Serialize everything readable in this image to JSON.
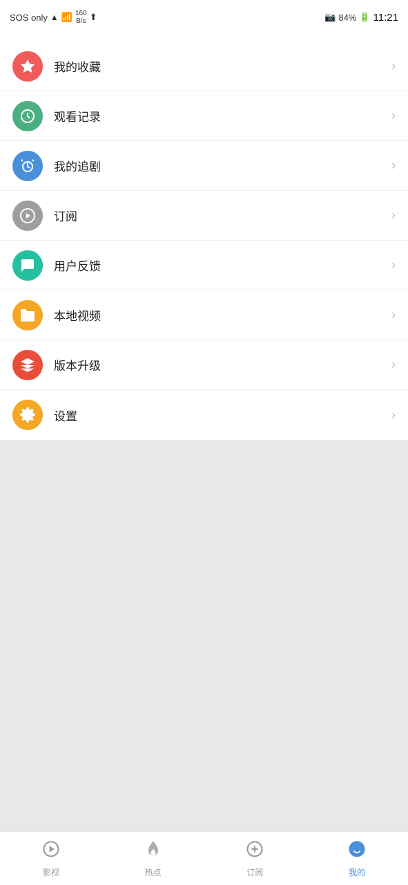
{
  "statusBar": {
    "sos": "SOS only",
    "signal": "!",
    "wifi": "WiFi",
    "speedNum": "160",
    "speedUnit": "B/s",
    "upload": "↑",
    "battery": "84%",
    "time": "11:21"
  },
  "menuItems": [
    {
      "id": "favorites",
      "label": "我的收藏",
      "iconColor": "color-red",
      "iconType": "star"
    },
    {
      "id": "history",
      "label": "观看记录",
      "iconColor": "color-green",
      "iconType": "clock"
    },
    {
      "id": "follow",
      "label": "我的追剧",
      "iconColor": "color-blue",
      "iconType": "alarm"
    },
    {
      "id": "subscribe",
      "label": "订阅",
      "iconColor": "color-gray",
      "iconType": "play"
    },
    {
      "id": "feedback",
      "label": "用户反馈",
      "iconColor": "color-teal",
      "iconType": "chat"
    },
    {
      "id": "local",
      "label": "本地视频",
      "iconColor": "color-orange",
      "iconType": "folder"
    },
    {
      "id": "update",
      "label": "版本升级",
      "iconColor": "color-multi",
      "iconType": "layers"
    },
    {
      "id": "settings",
      "label": "设置",
      "iconColor": "color-settings",
      "iconType": "gear"
    }
  ],
  "bottomNav": [
    {
      "id": "tv",
      "label": "影视",
      "iconType": "play-circle",
      "active": false
    },
    {
      "id": "hot",
      "label": "热点",
      "iconType": "fire",
      "active": false
    },
    {
      "id": "subscribe",
      "label": "订阅",
      "iconType": "plus-circle",
      "active": false
    },
    {
      "id": "mine",
      "label": "我的",
      "iconType": "smile",
      "active": true
    }
  ]
}
